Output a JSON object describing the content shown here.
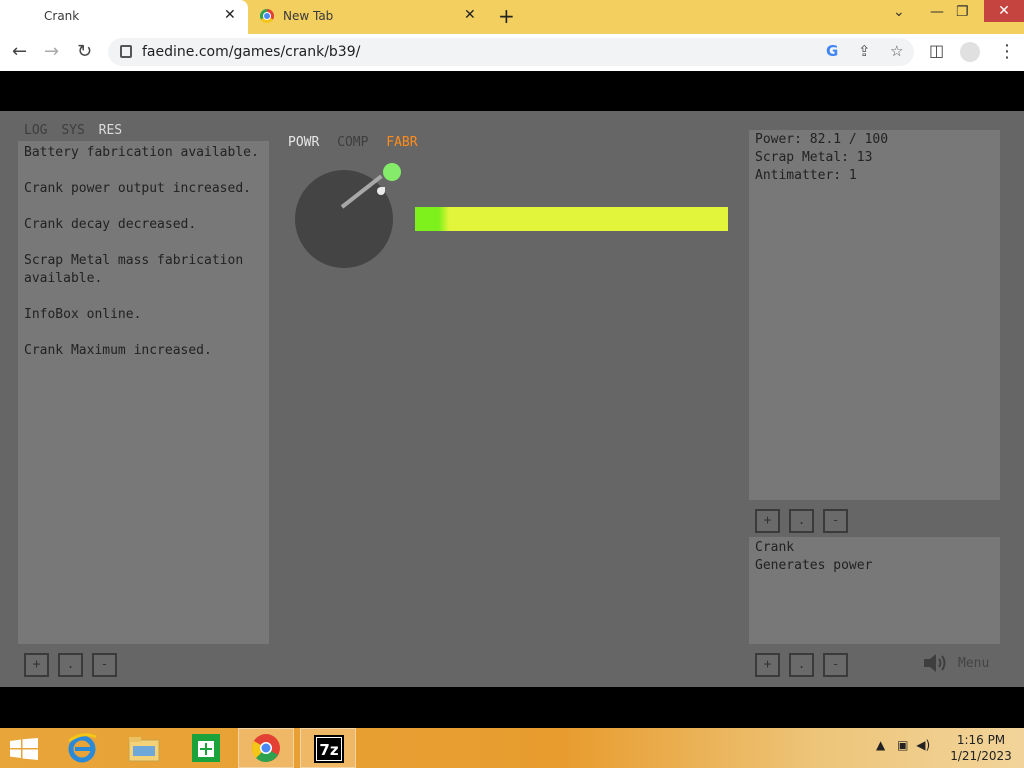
{
  "browser": {
    "tabs": [
      {
        "label": "Crank",
        "active": true
      },
      {
        "label": "New Tab",
        "active": false
      }
    ],
    "url": "faedine.com/games/crank/b39/"
  },
  "game": {
    "left_tabs": [
      "LOG",
      "SYS",
      "RES"
    ],
    "left_active_tab": "RES",
    "log_lines": [
      "Battery fabrication available.",
      "Crank power output increased.",
      "Crank decay decreased.",
      "Scrap Metal mass fabrication available.",
      "InfoBox online.",
      "Crank Maximum increased."
    ],
    "mid_tabs": [
      "POWR",
      "COMP",
      "FABR"
    ],
    "resources": {
      "power": "Power: 82.1 / 100",
      "scrap": "Scrap Metal: 13",
      "antimatter": "Antimatter: 1"
    },
    "power_fraction": 0.11,
    "info": {
      "title": "Crank",
      "description": "Generates power"
    },
    "buttons": {
      "plus": "+",
      "dot": ".",
      "minus": "-"
    },
    "menu_label": "Menu"
  },
  "taskbar": {
    "time": "1:16 PM",
    "date": "1/21/2023"
  },
  "colors": {
    "tab_bar": "#f2cf5e",
    "game_bg": "#666666",
    "panel_bg": "#787878",
    "bar_fill": "#7ef01b",
    "bar_bg": "#e2f53a",
    "fabr_tab": "#ff8c1a"
  }
}
